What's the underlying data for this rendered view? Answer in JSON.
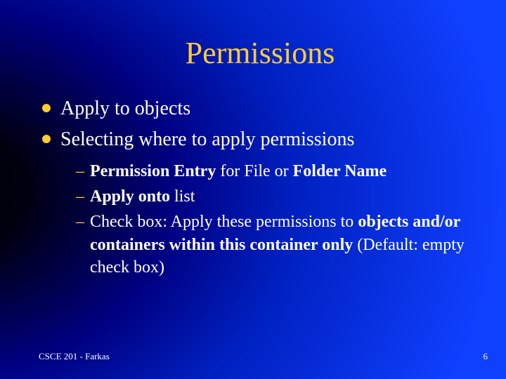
{
  "title": "Permissions",
  "bullets": [
    {
      "text": "Apply to objects"
    },
    {
      "text": "Selecting where to apply permissions"
    }
  ],
  "sub": [
    {
      "prefix_bold": "Permission Entry ",
      "mid": "for File or ",
      "suffix_bold": "Folder Name"
    },
    {
      "prefix_bold": "Apply onto ",
      "mid": "list",
      "suffix_bold": ""
    },
    {
      "line1": "Check box: Apply these permissions to ",
      "bold1": "objects and/or containers within this container only ",
      "line2": "(Default: empty check box)"
    }
  ],
  "footer": {
    "left": "CSCE 201 - Farkas",
    "right": "6"
  }
}
